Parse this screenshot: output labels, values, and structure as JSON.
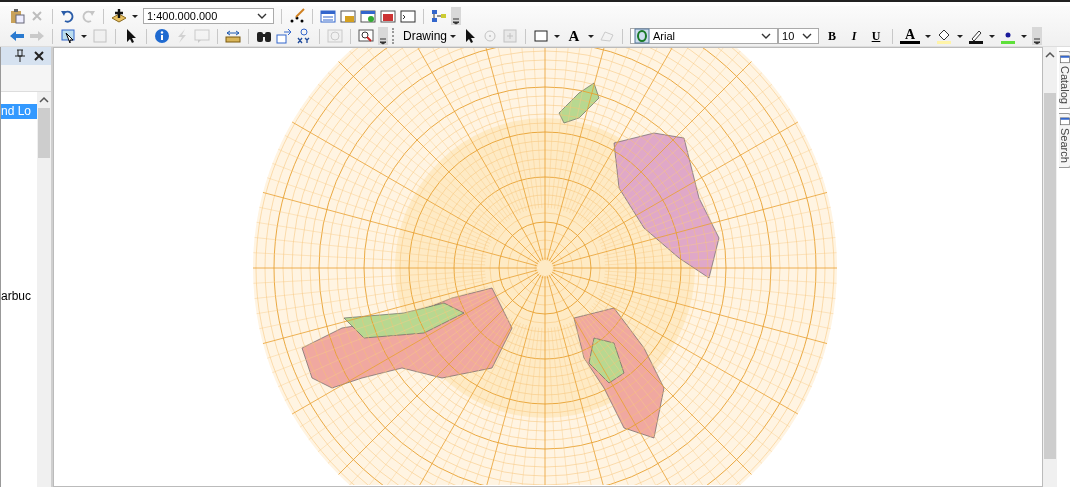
{
  "standard_toolbar": {
    "scale": "1:400.000.000"
  },
  "drawing_toolbar": {
    "menu": "Drawing",
    "text_tool": "A",
    "font": "Arial",
    "font_size": "10",
    "bold": "B",
    "italic": "I",
    "underline": "U",
    "font_color": "A"
  },
  "table_of_contents": {
    "items": [
      {
        "label": "nd Lo",
        "selected": true
      },
      {
        "label": "arbuc",
        "selected": false
      }
    ]
  },
  "side_tabs": [
    {
      "label": "Catalog"
    },
    {
      "label": "Search"
    }
  ]
}
